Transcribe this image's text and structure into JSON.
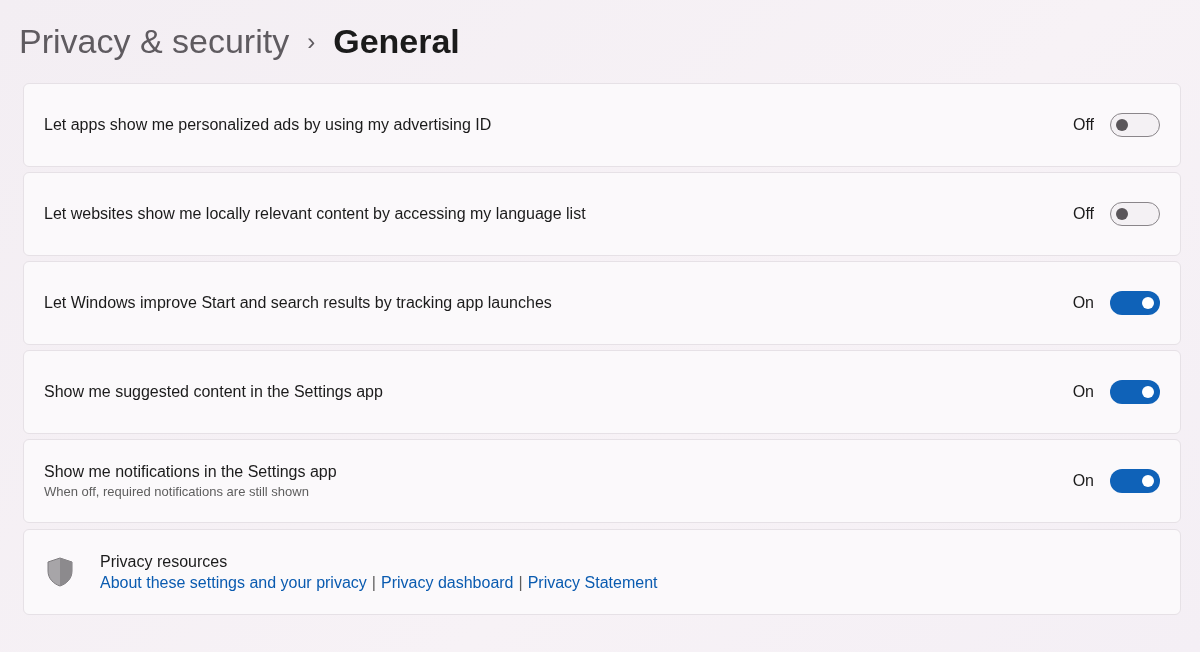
{
  "breadcrumb": {
    "parent": "Privacy & security",
    "separator": "›",
    "current": "General"
  },
  "settings": [
    {
      "label": "Let apps show me personalized ads by using my advertising ID",
      "state": "Off",
      "on": false
    },
    {
      "label": "Let websites show me locally relevant content by accessing my language list",
      "state": "Off",
      "on": false
    },
    {
      "label": "Let Windows improve Start and search results by tracking app launches",
      "state": "On",
      "on": true
    },
    {
      "label": "Show me suggested content in the Settings app",
      "state": "On",
      "on": true
    },
    {
      "label": "Show me notifications in the Settings app",
      "description": "When off, required notifications are still shown",
      "state": "On",
      "on": true
    }
  ],
  "resources": {
    "title": "Privacy resources",
    "links": [
      "About these settings and your privacy",
      "Privacy dashboard",
      "Privacy Statement"
    ],
    "separators": [
      "|",
      "|"
    ]
  }
}
